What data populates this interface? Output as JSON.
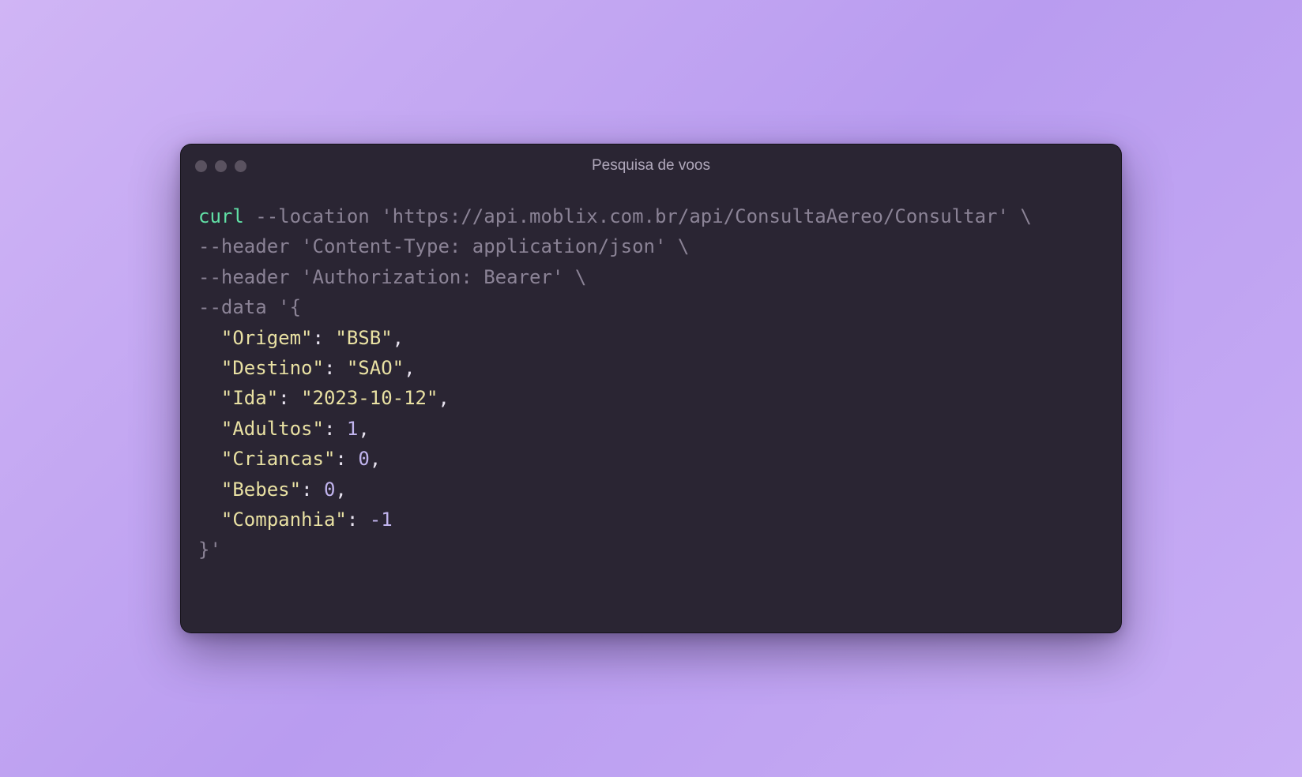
{
  "window": {
    "title": "Pesquisa de voos"
  },
  "code": {
    "cmd": "curl",
    "flag_location": "--location",
    "url": "'https://api.moblix.com.br/api/ConsultaAereo/Consultar'",
    "backslash": "\\",
    "flag_header1": "--header",
    "header1_val": "'Content-Type: application/json'",
    "flag_header2": "--header",
    "header2_val": "'Authorization: Bearer'",
    "flag_data": "--data",
    "data_open": "'{",
    "k_origem": "\"Origem\"",
    "v_origem": "\"BSB\"",
    "k_destino": "\"Destino\"",
    "v_destino": "\"SAO\"",
    "k_ida": "\"Ida\"",
    "v_ida": "\"2023-10-12\"",
    "k_adultos": "\"Adultos\"",
    "v_adultos": "1",
    "k_criancas": "\"Criancas\"",
    "v_criancas": "0",
    "k_bebes": "\"Bebes\"",
    "v_bebes": "0",
    "k_companhia": "\"Companhia\"",
    "v_companhia": "-1",
    "data_close": "}'",
    "colon": ":",
    "comma": ",",
    "indent2": "  ",
    "space": " "
  }
}
